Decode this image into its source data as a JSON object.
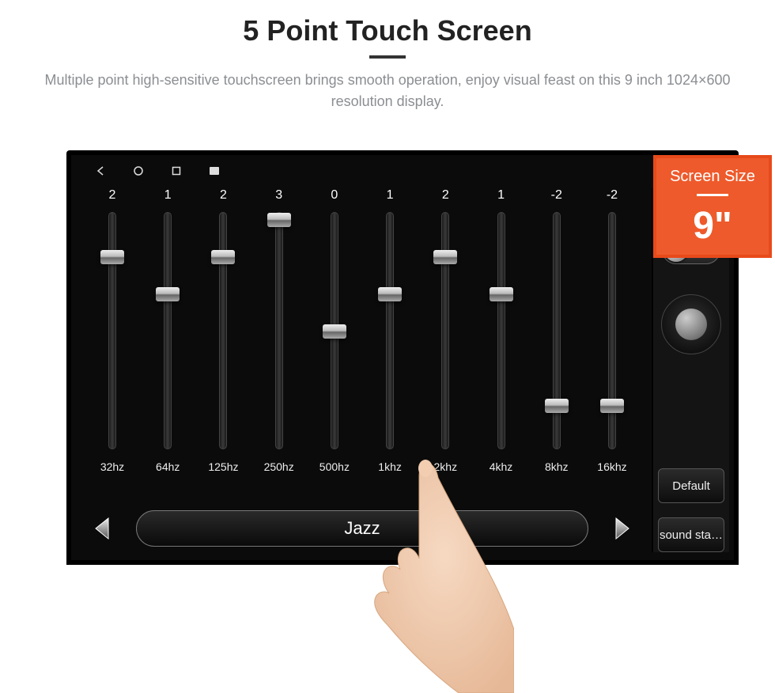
{
  "header": {
    "title": "5 Point Touch Screen",
    "subtitle": "Multiple point high-sensitive touchscreen brings smooth operation, enjoy visual feast on this 9 inch 1024×600 resolution display."
  },
  "callout": {
    "label": "Screen Size",
    "value": "9\""
  },
  "equalizer": {
    "scale": {
      "max": "3",
      "mid": "0",
      "min": "-3"
    },
    "bands": [
      {
        "value": "2",
        "freq": "32hz",
        "pos": 0.167
      },
      {
        "value": "1",
        "freq": "64hz",
        "pos": 0.333
      },
      {
        "value": "2",
        "freq": "125hz",
        "pos": 0.167
      },
      {
        "value": "3",
        "freq": "250hz",
        "pos": 0.0
      },
      {
        "value": "0",
        "freq": "500hz",
        "pos": 0.5
      },
      {
        "value": "1",
        "freq": "1khz",
        "pos": 0.333
      },
      {
        "value": "2",
        "freq": "2khz",
        "pos": 0.167
      },
      {
        "value": "1",
        "freq": "4khz",
        "pos": 0.333
      },
      {
        "value": "-2",
        "freq": "8khz",
        "pos": 0.833
      },
      {
        "value": "-2",
        "freq": "16khz",
        "pos": 0.833
      }
    ],
    "preset": "Jazz"
  },
  "side": {
    "default_label": "Default",
    "sound_label": "sound sta…"
  }
}
